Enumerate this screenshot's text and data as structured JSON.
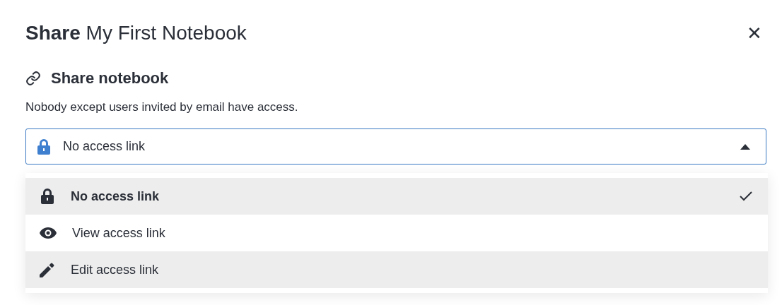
{
  "dialog": {
    "title": "**Share** My First Notebook",
    "close_label": "✕"
  },
  "section": {
    "heading": "Share notebook",
    "description": "Nobody except users invited by email have access."
  },
  "select": {
    "value": "No access link",
    "kind": "lock",
    "expanded": true
  },
  "options": [
    {
      "label": "No access link",
      "kind": "lock",
      "selected": true,
      "highlighted": true
    },
    {
      "label": "View access link",
      "kind": "eye",
      "selected": false,
      "highlighted": false
    },
    {
      "label": "Edit access link",
      "kind": "pencil",
      "selected": false,
      "highlighted": true
    }
  ]
}
